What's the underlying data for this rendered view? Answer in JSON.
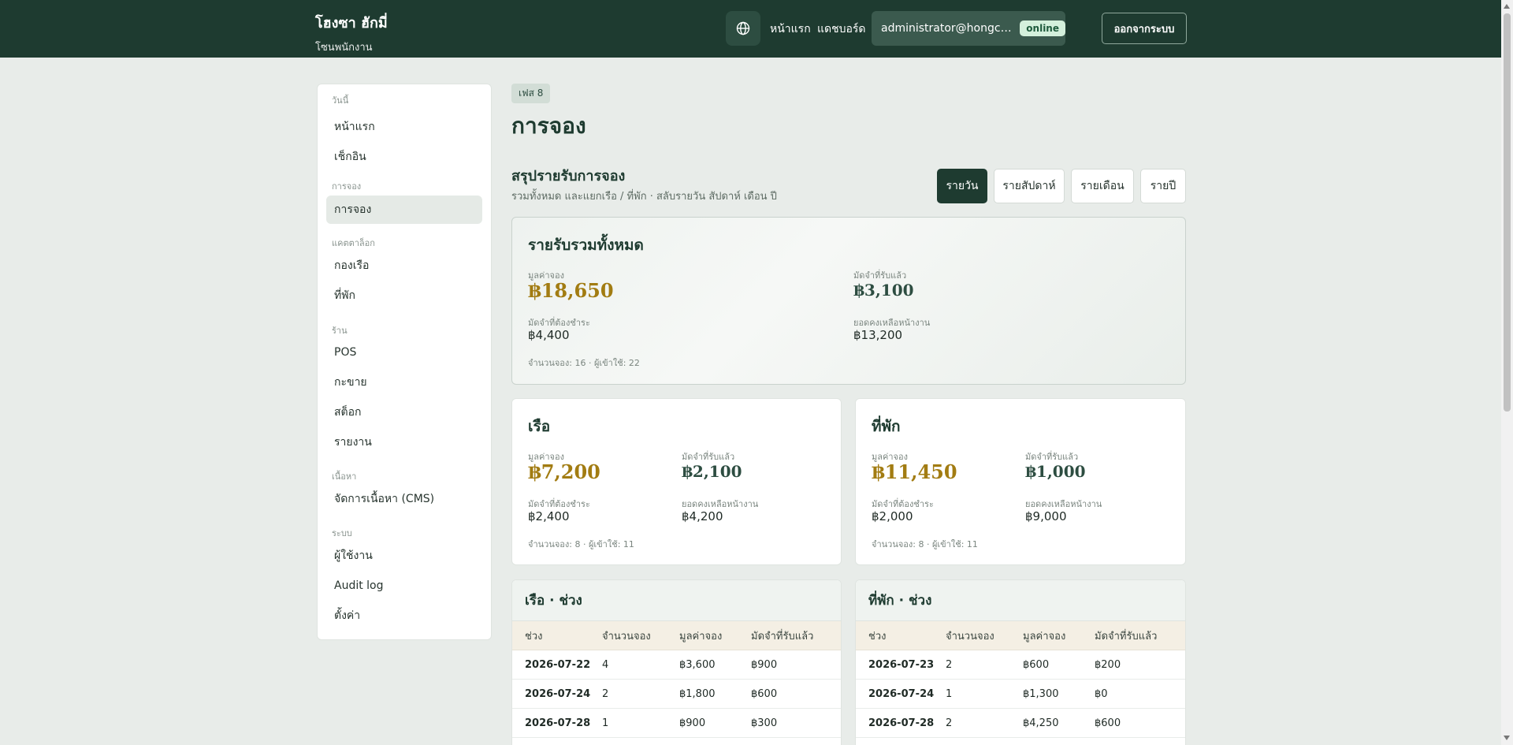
{
  "header": {
    "brand_title": "โฮงซา ฮักมี่",
    "brand_sub": "โซนพนักงาน",
    "nav_home": "หน้าแรก",
    "nav_dashboard": "แดชบอร์ด",
    "user_email": "administrator@hongchahug...",
    "status": "online",
    "logout": "ออกจากระบบ"
  },
  "sidebar": {
    "sections": {
      "today": "วันนี้",
      "booking": "การจอง",
      "catalog": "แคตตาล็อก",
      "shop": "ร้าน",
      "content": "เนื้อหา",
      "system": "ระบบ"
    },
    "items": {
      "home": "หน้าแรก",
      "checkin": "เช็กอิน",
      "bookings": "การจอง",
      "fleet": "กองเรือ",
      "lodging": "ที่พัก",
      "pos": "POS",
      "cart": "กะขาย",
      "stock": "สต็อก",
      "reports": "รายงาน",
      "cms": "จัดการเนื้อหา (CMS)",
      "users": "ผู้ใช้งาน",
      "audit": "Audit log",
      "settings": "ตั้งค่า"
    }
  },
  "main": {
    "phase": "เฟส 8",
    "title": "การจอง",
    "summary_title": "สรุปรายรับการจอง",
    "summary_sub": "รวมทั้งหมด และแยกเรือ / ที่พัก · สลับรายวัน สัปดาห์ เดือน ปี",
    "periods": [
      "รายวัน",
      "รายสัปดาห์",
      "รายเดือน",
      "รายปี"
    ]
  },
  "labels": {
    "booking_value": "มูลค่าจอง",
    "deposit_received": "มัดจำที่รับแล้ว",
    "deposit_due": "มัดจำที่ต้องชำระ",
    "balance_onsite": "ยอดคงเหลือหน้างาน"
  },
  "total": {
    "title": "รายรับรวมทั้งหมด",
    "booking_value": "฿18,650",
    "deposit_received": "฿3,100",
    "deposit_due": "฿4,400",
    "balance_onsite": "฿13,200",
    "footer": "จำนวนจอง: 16 · ผู้เข้าใช้: 22"
  },
  "boat": {
    "title": "เรือ",
    "booking_value": "฿7,200",
    "deposit_received": "฿2,100",
    "deposit_due": "฿2,400",
    "balance_onsite": "฿4,200",
    "footer": "จำนวนจอง: 8 · ผู้เข้าใช้: 11"
  },
  "lodge": {
    "title": "ที่พัก",
    "booking_value": "฿11,450",
    "deposit_received": "฿1,000",
    "deposit_due": "฿2,000",
    "balance_onsite": "฿9,000",
    "footer": "จำนวนจอง: 8 · ผู้เข้าใช้: 11"
  },
  "boat_table": {
    "title": "เรือ · ช่วง",
    "columns": [
      "ช่วง",
      "จำนวนจอง",
      "มูลค่าจอง",
      "มัดจำที่รับแล้ว"
    ],
    "rows": [
      [
        "2026-07-22",
        "4",
        "฿3,600",
        "฿900"
      ],
      [
        "2026-07-24",
        "2",
        "฿1,800",
        "฿600"
      ],
      [
        "2026-07-28",
        "1",
        "฿900",
        "฿300"
      ]
    ]
  },
  "lodge_table": {
    "title": "ที่พัก · ช่วง",
    "columns": [
      "ช่วง",
      "จำนวนจอง",
      "มูลค่าจอง",
      "มัดจำที่รับแล้ว"
    ],
    "rows": [
      [
        "2026-07-23",
        "2",
        "฿600",
        "฿200"
      ],
      [
        "2026-07-24",
        "1",
        "฿1,300",
        "฿0"
      ],
      [
        "2026-07-28",
        "2",
        "฿4,250",
        "฿600"
      ]
    ]
  }
}
